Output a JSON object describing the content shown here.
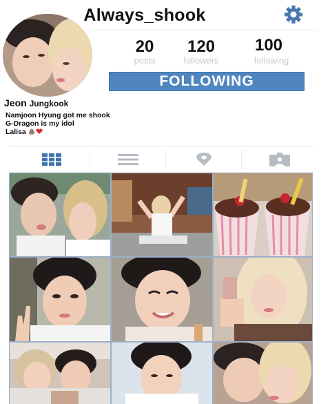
{
  "profile": {
    "username": "Always_shook",
    "stats": [
      {
        "value": "20",
        "label": "posts"
      },
      {
        "value": "120",
        "label": "followers"
      },
      {
        "value": "100",
        "label": "following"
      }
    ],
    "follow_button": "FOLLOWING",
    "bio": {
      "name_first": "Jeon",
      "name_last": "Jungkook",
      "lines": [
        "Namjoon Hyung got me shook",
        "G-Dragon is my idol",
        "Lalisa"
      ],
      "emoji_names": [
        "poop-emoji",
        "heart-emoji"
      ]
    }
  },
  "tabs": [
    {
      "name": "grid-view",
      "icon": "grid-icon",
      "active": true
    },
    {
      "name": "list-view",
      "icon": "list-icon",
      "active": false
    },
    {
      "name": "map-view",
      "icon": "location-pin-icon",
      "active": false
    },
    {
      "name": "tagged-view",
      "icon": "tagged-photo-icon",
      "active": false
    }
  ],
  "colors": {
    "accent": "#4f86c0",
    "active_tab": "#3f73aa",
    "inactive_tab": "#b5bcc4",
    "muted_text": "#c9c9c9"
  },
  "photos": [
    {
      "subject": "selfie-duo-peace-sign"
    },
    {
      "subject": "woman-on-floor-arms-raised"
    },
    {
      "subject": "two-ice-cream-sundaes"
    },
    {
      "subject": "boy-peace-sign-car"
    },
    {
      "subject": "boy-smiling-closeup"
    },
    {
      "subject": "blonde-woman-with-phone"
    },
    {
      "subject": "couple-hugging-selfie"
    },
    {
      "subject": "boy-white-shirt-closeup"
    },
    {
      "subject": "couple-cheek-to-cheek"
    }
  ]
}
